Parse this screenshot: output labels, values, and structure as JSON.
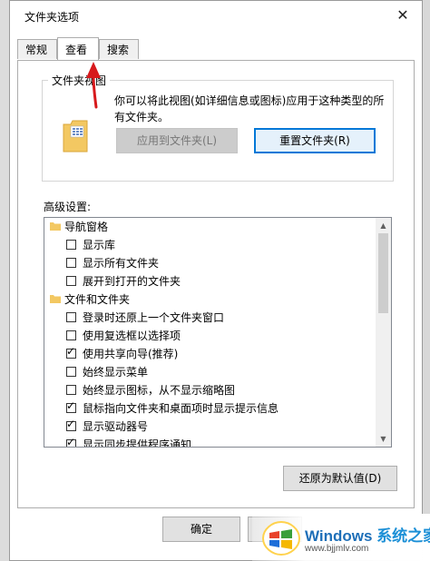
{
  "window": {
    "title": "文件夹选项",
    "close_glyph": "✕"
  },
  "tabs": [
    {
      "label": "常规",
      "active": false
    },
    {
      "label": "查看",
      "active": true
    },
    {
      "label": "搜索",
      "active": false
    }
  ],
  "folder_views": {
    "group_label": "文件夹视图",
    "description": "你可以将此视图(如详细信息或图标)应用于这种类型的所有文件夹。",
    "apply_button": "应用到文件夹(L)",
    "reset_button": "重置文件夹(R)",
    "icon": "folder-icon"
  },
  "advanced": {
    "label": "高级设置:",
    "items": [
      {
        "type": "folder",
        "label": "导航窗格"
      },
      {
        "type": "check",
        "label": "显示库",
        "checked": false
      },
      {
        "type": "check",
        "label": "显示所有文件夹",
        "checked": false
      },
      {
        "type": "check",
        "label": "展开到打开的文件夹",
        "checked": false
      },
      {
        "type": "folder",
        "label": "文件和文件夹"
      },
      {
        "type": "check",
        "label": "登录时还原上一个文件夹窗口",
        "checked": false
      },
      {
        "type": "check",
        "label": "使用复选框以选择项",
        "checked": false
      },
      {
        "type": "check",
        "label": "使用共享向导(推荐)",
        "checked": true
      },
      {
        "type": "check",
        "label": "始终显示菜单",
        "checked": false
      },
      {
        "type": "check",
        "label": "始终显示图标，从不显示缩略图",
        "checked": false
      },
      {
        "type": "check",
        "label": "鼠标指向文件夹和桌面项时显示提示信息",
        "checked": true
      },
      {
        "type": "check",
        "label": "显示驱动器号",
        "checked": true
      },
      {
        "type": "check",
        "label": "显示同步提供程序通知",
        "checked": true
      }
    ],
    "restore_button": "还原为默认值(D)"
  },
  "footer": {
    "ok_button": "确定"
  },
  "watermark": {
    "title": "Windows",
    "title_cn": "系统之家",
    "url": "www.bjjmlv.com"
  },
  "colors": {
    "accent": "#0078d7",
    "arrow": "#d7191c"
  }
}
